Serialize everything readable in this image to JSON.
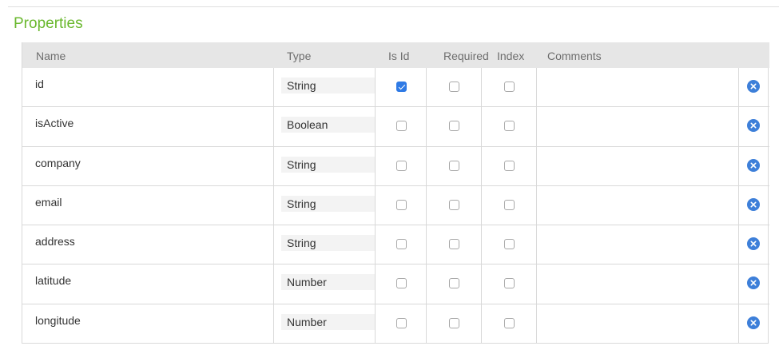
{
  "section": {
    "title": "Properties"
  },
  "table": {
    "headers": {
      "name": "Name",
      "type": "Type",
      "is_id": "Is Id",
      "required": "Required",
      "index": "Index",
      "comments": "Comments"
    },
    "rows": [
      {
        "name": "id",
        "type": "String",
        "is_id": true,
        "required": false,
        "index": false,
        "comments": ""
      },
      {
        "name": "isActive",
        "type": "Boolean",
        "is_id": false,
        "required": false,
        "index": false,
        "comments": ""
      },
      {
        "name": "company",
        "type": "String",
        "is_id": false,
        "required": false,
        "index": false,
        "comments": ""
      },
      {
        "name": "email",
        "type": "String",
        "is_id": false,
        "required": false,
        "index": false,
        "comments": ""
      },
      {
        "name": "address",
        "type": "String",
        "is_id": false,
        "required": false,
        "index": false,
        "comments": ""
      },
      {
        "name": "latitude",
        "type": "Number",
        "is_id": false,
        "required": false,
        "index": false,
        "comments": ""
      },
      {
        "name": "longitude",
        "type": "Number",
        "is_id": false,
        "required": false,
        "index": false,
        "comments": ""
      }
    ],
    "delete_icon": "close-circle-icon"
  },
  "colors": {
    "title": "#6ab82e",
    "header_bg": "#e6e6e6",
    "checkbox_checked": "#2f7ae5",
    "delete_button": "#3d7fd9"
  }
}
